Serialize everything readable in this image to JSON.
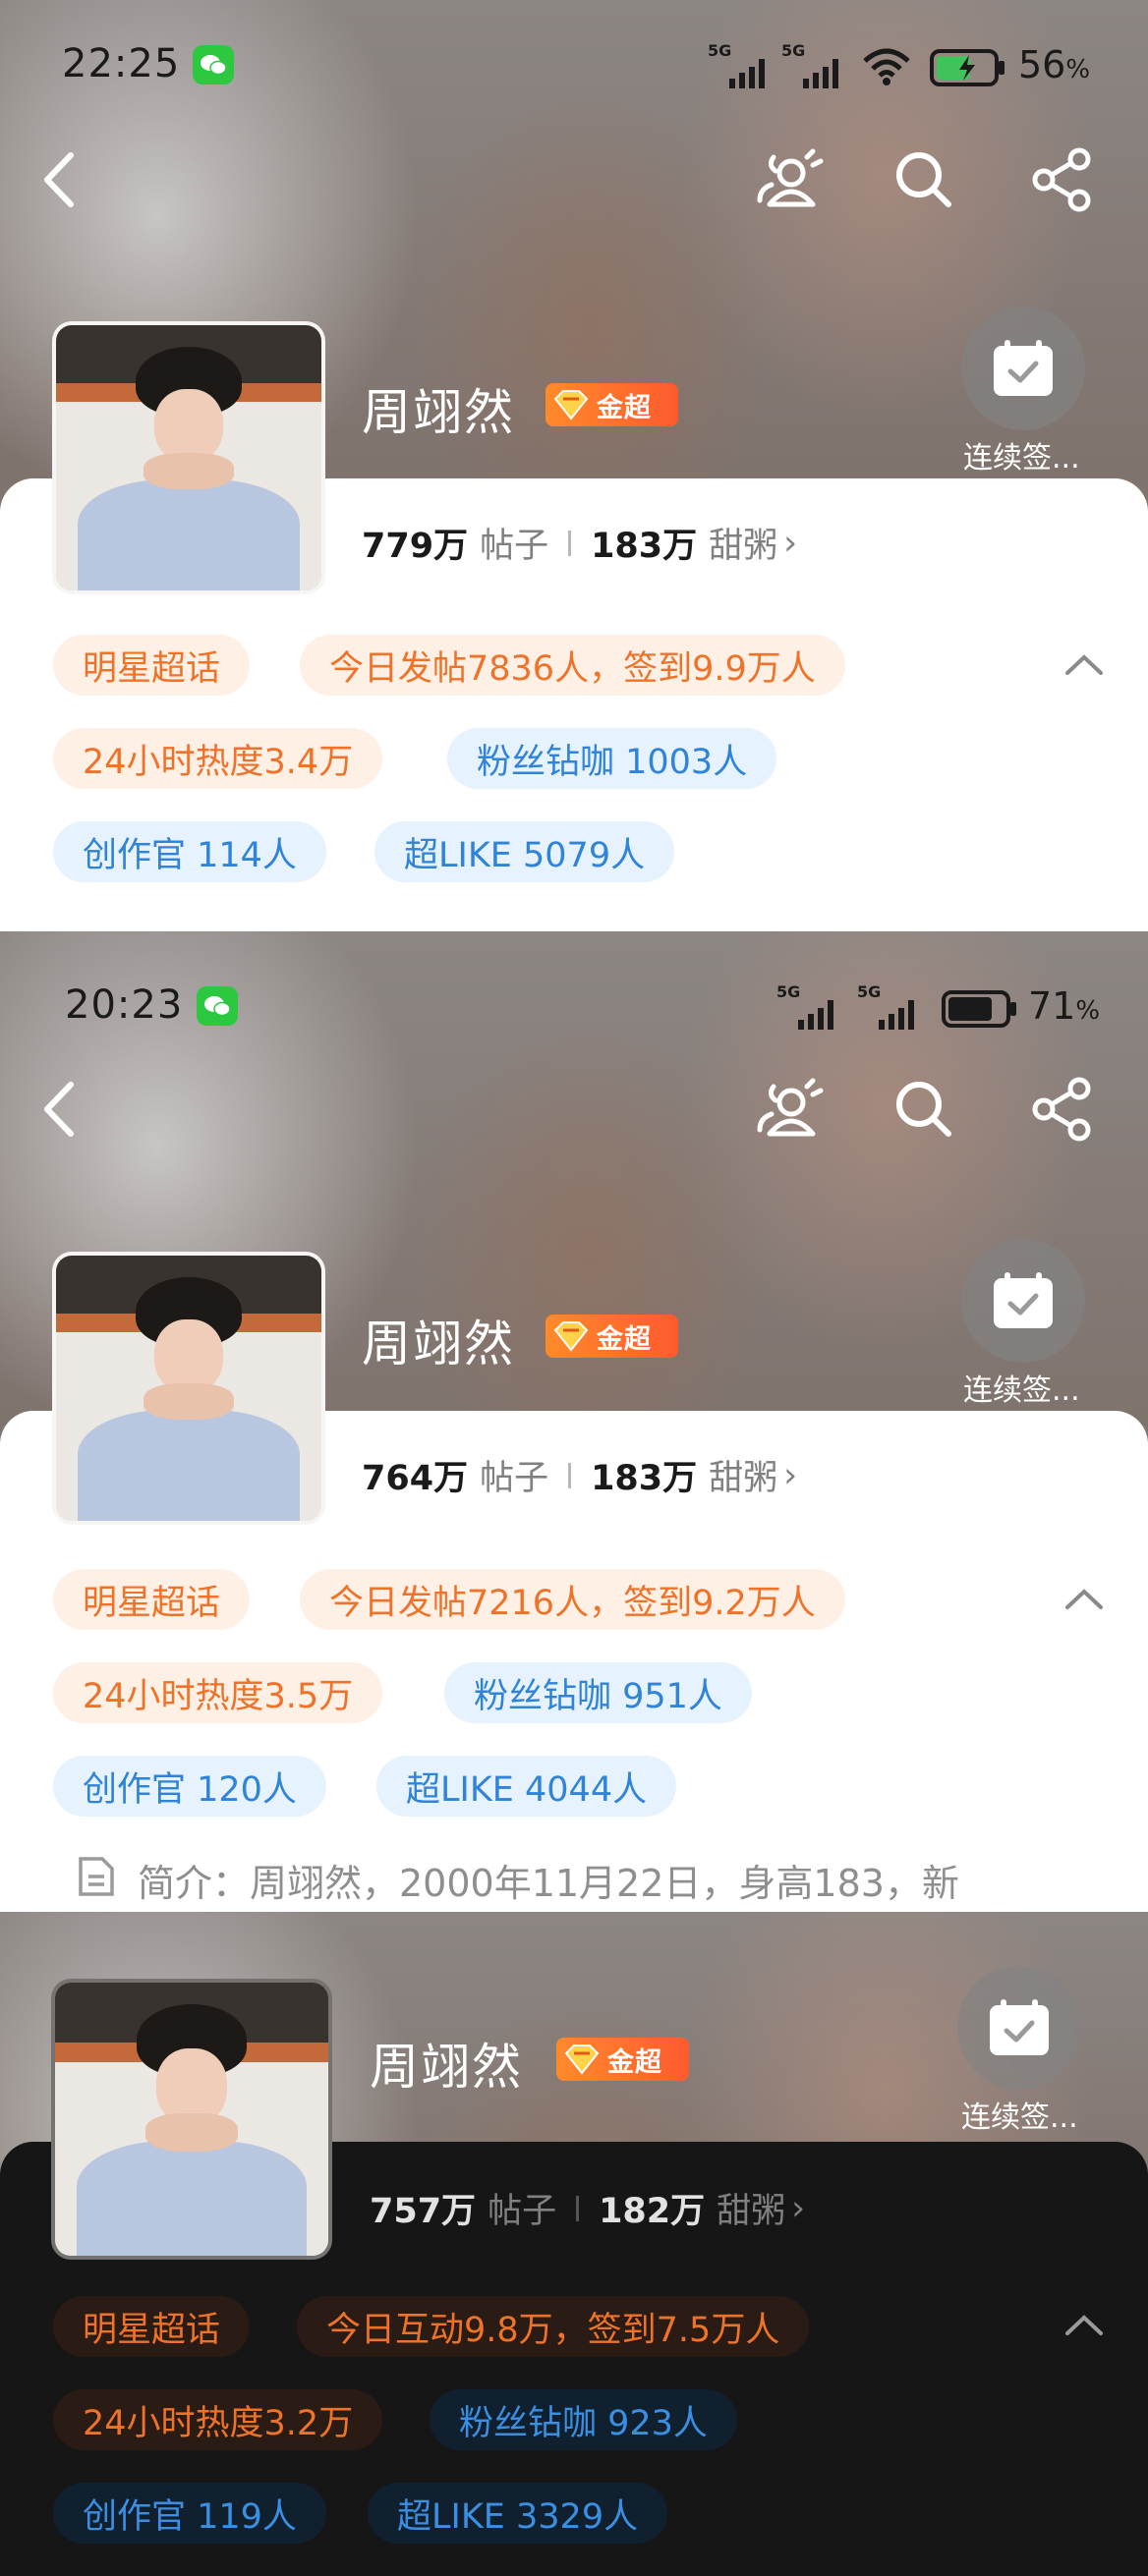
{
  "colors": {
    "orange_chip_text": "#ee7329",
    "blue_chip_text": "#2f83d9",
    "gold_badge": "#ff6a2c",
    "wechat_green": "#2bc840"
  },
  "panels": [
    {
      "status": {
        "time": "22:25",
        "signal1": "5G",
        "signal2": "5G",
        "battery": "56",
        "battery_unit": "%"
      },
      "topic": {
        "name": "周翊然",
        "badge": "金超",
        "checkin_label": "连续签..."
      },
      "stats": {
        "posts_value": "779万",
        "posts_label": "帖子",
        "fans_value": "183万",
        "fans_label": "甜粥",
        "chevron": "›"
      },
      "chips": {
        "star": "明星超话",
        "today": "今日发帖7836人，签到9.9万人",
        "heat": "24小时热度3.4万",
        "fan_vip": "粉丝钻咖 1003人",
        "creator": "创作官 114人",
        "superlike": "超LIKE 5079人"
      }
    },
    {
      "status": {
        "time": "20:23",
        "signal1": "5G",
        "signal2": "5G",
        "battery": "71",
        "battery_unit": "%"
      },
      "topic": {
        "name": "周翊然",
        "badge": "金超",
        "checkin_label": "连续签..."
      },
      "stats": {
        "posts_value": "764万",
        "posts_label": "帖子",
        "fans_value": "183万",
        "fans_label": "甜粥",
        "chevron": "›"
      },
      "chips": {
        "star": "明星超话",
        "today": "今日发帖7216人，签到9.2万人",
        "heat": "24小时热度3.5万",
        "fan_vip": "粉丝钻咖 951人",
        "creator": "创作官 120人",
        "superlike": "超LIKE 4044人"
      },
      "intro": "简介：周翊然，2000年11月22日，身高183，新"
    },
    {
      "topic": {
        "name": "周翊然",
        "badge": "金超",
        "checkin_label": "连续签..."
      },
      "stats": {
        "posts_value": "757万",
        "posts_label": "帖子",
        "fans_value": "182万",
        "fans_label": "甜粥",
        "chevron": "›"
      },
      "chips": {
        "star": "明星超话",
        "today": "今日互动9.8万，签到7.5万人",
        "heat": "24小时热度3.2万",
        "fan_vip": "粉丝钻咖 923人",
        "creator": "创作官 119人",
        "superlike": "超LIKE 3329人"
      }
    }
  ]
}
